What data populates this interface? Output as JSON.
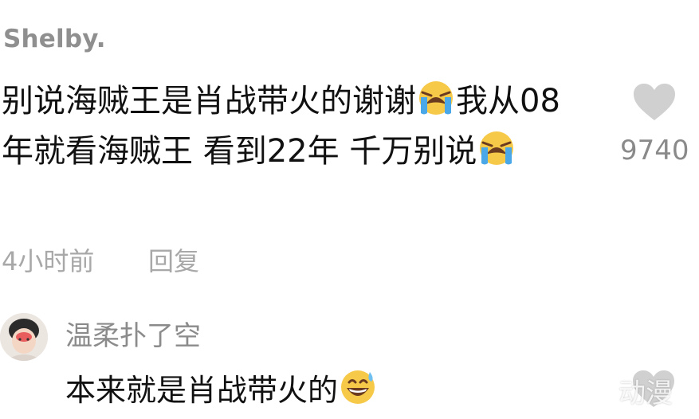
{
  "comment": {
    "username": "Shelby.",
    "text_part1": "别说海贼王是肖战带火的谢谢",
    "emoji1": "loudly-crying-face",
    "text_part2": "我从08年就看海贼王 看到22年 千万别说",
    "emoji2": "loudly-crying-face",
    "like_icon": "heart-icon",
    "like_count": "9740",
    "time": "4小时前",
    "reply_label": "回复"
  },
  "reply": {
    "avatar_icon": "user-avatar",
    "username": "温柔扑了空",
    "text": "本来就是肖战带火的",
    "emoji": "grinning-face-with-sweat",
    "like_icon": "heart-icon"
  },
  "watermark": "动漫",
  "colors": {
    "heart": "#d0d0d0",
    "username": "#8f8f8f",
    "meta": "#a8a8a8",
    "text": "#111111"
  }
}
